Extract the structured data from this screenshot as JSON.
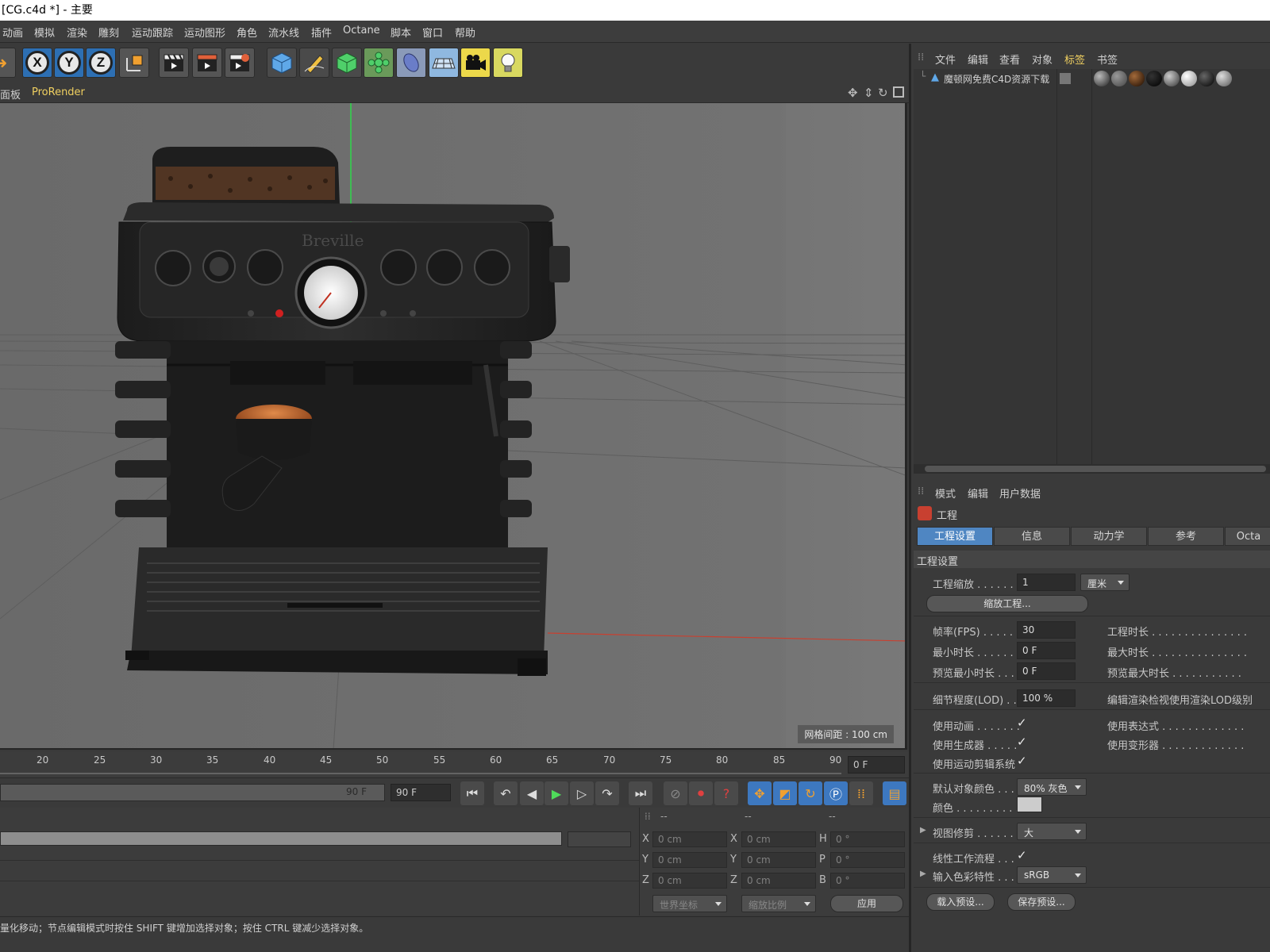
{
  "window": {
    "title": "[CG.c4d *] - 主要"
  },
  "menubar": {
    "items": [
      "动画",
      "模拟",
      "渲染",
      "雕刻",
      "运动跟踪",
      "运动图形",
      "角色",
      "流水线",
      "插件",
      "Octane",
      "脚本",
      "窗口",
      "帮助"
    ]
  },
  "toolbar": {
    "axis_labels": [
      "X",
      "Y",
      "Z"
    ],
    "icons": [
      "arrow-icon",
      "x-axis-icon",
      "y-axis-icon",
      "z-axis-icon",
      "coordinate-system-icon",
      "render-view-icon",
      "render-picture-viewer-icon",
      "render-settings-icon",
      "cube-icon",
      "pen-icon",
      "subdivision-icon",
      "cloner-icon",
      "deformer-icon",
      "floor-icon",
      "camera-icon",
      "light-icon"
    ]
  },
  "viewport": {
    "menu": [
      "面板",
      "ProRender"
    ],
    "grid_label": "网格间距 : 100 cm",
    "brand_text": "Breville"
  },
  "timeline": {
    "ticks": [
      "20",
      "25",
      "30",
      "35",
      "40",
      "45",
      "50",
      "55",
      "60",
      "65",
      "70",
      "75",
      "80",
      "85",
      "90"
    ],
    "current_frame": "0 F",
    "end_label": "90 F",
    "end_field": "90 F"
  },
  "coords": {
    "headers": [
      "--",
      "--",
      "--"
    ],
    "rows": [
      {
        "a": "X",
        "av": "0 cm",
        "b": "X",
        "bv": "0 cm",
        "c": "H",
        "cv": "0 °"
      },
      {
        "a": "Y",
        "av": "0 cm",
        "b": "Y",
        "bv": "0 cm",
        "c": "P",
        "cv": "0 °"
      },
      {
        "a": "Z",
        "av": "0 cm",
        "b": "Z",
        "bv": "0 cm",
        "c": "B",
        "cv": "0 °"
      }
    ],
    "world_dd": "世界坐标",
    "scale_dd": "缩放比例",
    "apply": "应用"
  },
  "status": {
    "text": "量化移动；节点编辑模式时按住 SHIFT 键增加选择对象；按住 CTRL 键减少选择对象。"
  },
  "object_manager": {
    "menu": [
      "文件",
      "编辑",
      "查看",
      "对象",
      "标签",
      "书签"
    ],
    "active_menu": "标签",
    "object_name": "魔顿网免费C4D资源下载"
  },
  "attribute_manager": {
    "menu": [
      "模式",
      "编辑",
      "用户数据"
    ],
    "header": "工程",
    "tabs": [
      "工程设置",
      "信息",
      "动力学",
      "参考",
      "Octa"
    ],
    "section": "工程设置",
    "project_scale_label": "工程缩放 . . . . . . .",
    "project_scale_value": "1",
    "project_scale_unit": "厘米",
    "scale_project_btn": "缩放工程...",
    "fps_label": "帧率(FPS) . . . . . .",
    "fps_value": "30",
    "min_time_label": "最小时长 . . . . . . .",
    "min_time_value": "0 F",
    "preview_min_label": "预览最小时长 . . .",
    "preview_min_value": "0 F",
    "project_time_label": "工程时长 . . . . . . . . . . . . . . .",
    "max_time_label": "最大时长 . . . . . . . . . . . . . . .",
    "preview_max_label": "预览最大时长 . . . . . . . . . . .",
    "lod_label": "细节程度(LOD) . .",
    "lod_value": "100 %",
    "lod_right_label": "编辑渲染检视使用渲染LOD级别",
    "use_anim_label": "使用动画 . . . . . . .",
    "use_gen_label": "使用生成器 . . . . .",
    "use_motion_label": "使用运动剪辑系统",
    "use_expr_label": "使用表达式 . . . . . . . . . . . . .",
    "use_deform_label": "使用变形器 . . . . . . . . . . . . .",
    "default_color_label": "默认对象颜色 . . .",
    "default_color_value": "80% 灰色",
    "color_label": "颜色 . . . . . . . . . .",
    "view_clip_label": "视图修剪 . . . . . . .",
    "view_clip_value": "大",
    "linear_label": "线性工作流程 . . .",
    "input_color_label": "输入色彩特性 . . .",
    "input_color_value": "sRGB",
    "load_preset": "载入预设...",
    "save_preset": "保存预设...",
    "checkmark": "✓"
  }
}
